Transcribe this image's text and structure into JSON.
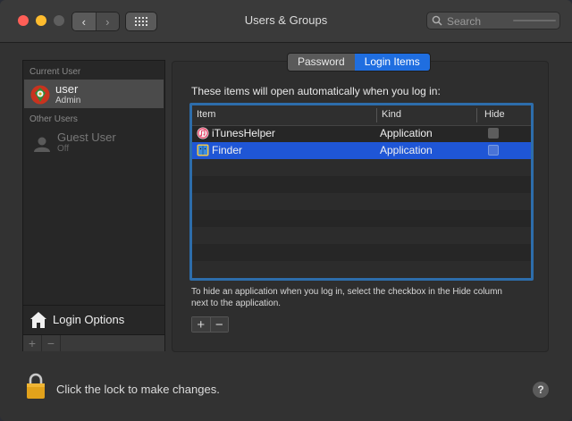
{
  "window": {
    "title": "Users & Groups"
  },
  "toolbar": {
    "search_placeholder": "Search"
  },
  "sidebar": {
    "current_user_label": "Current User",
    "current_user": {
      "name": "user",
      "role": "Admin"
    },
    "other_users_label": "Other Users",
    "guest": {
      "name": "Guest User",
      "status": "Off"
    },
    "login_options_label": "Login Options",
    "add_label": "+",
    "remove_label": "−"
  },
  "tabs": [
    {
      "label": "Password",
      "active": false
    },
    {
      "label": "Login Items",
      "active": true
    }
  ],
  "login_items": {
    "intro": "These items will open automatically when you log in:",
    "columns": {
      "item": "Item",
      "kind": "Kind",
      "hide": "Hide"
    },
    "rows": [
      {
        "item": "iTunesHelper",
        "kind": "Application",
        "hide": false,
        "selected": false,
        "icon": "itunes-icon"
      },
      {
        "item": "Finder",
        "kind": "Application",
        "hide": false,
        "selected": true,
        "icon": "finder-icon"
      }
    ],
    "hint": "To hide an application when you log in, select the checkbox in the Hide column next to the application.",
    "add_label": "+",
    "remove_label": "−"
  },
  "footer": {
    "lock_text": "Click the lock to make changes.",
    "help_label": "?"
  },
  "colors": {
    "accent": "#1f6ee0",
    "selection": "#1f56d6",
    "table_border": "#2d6dab"
  }
}
